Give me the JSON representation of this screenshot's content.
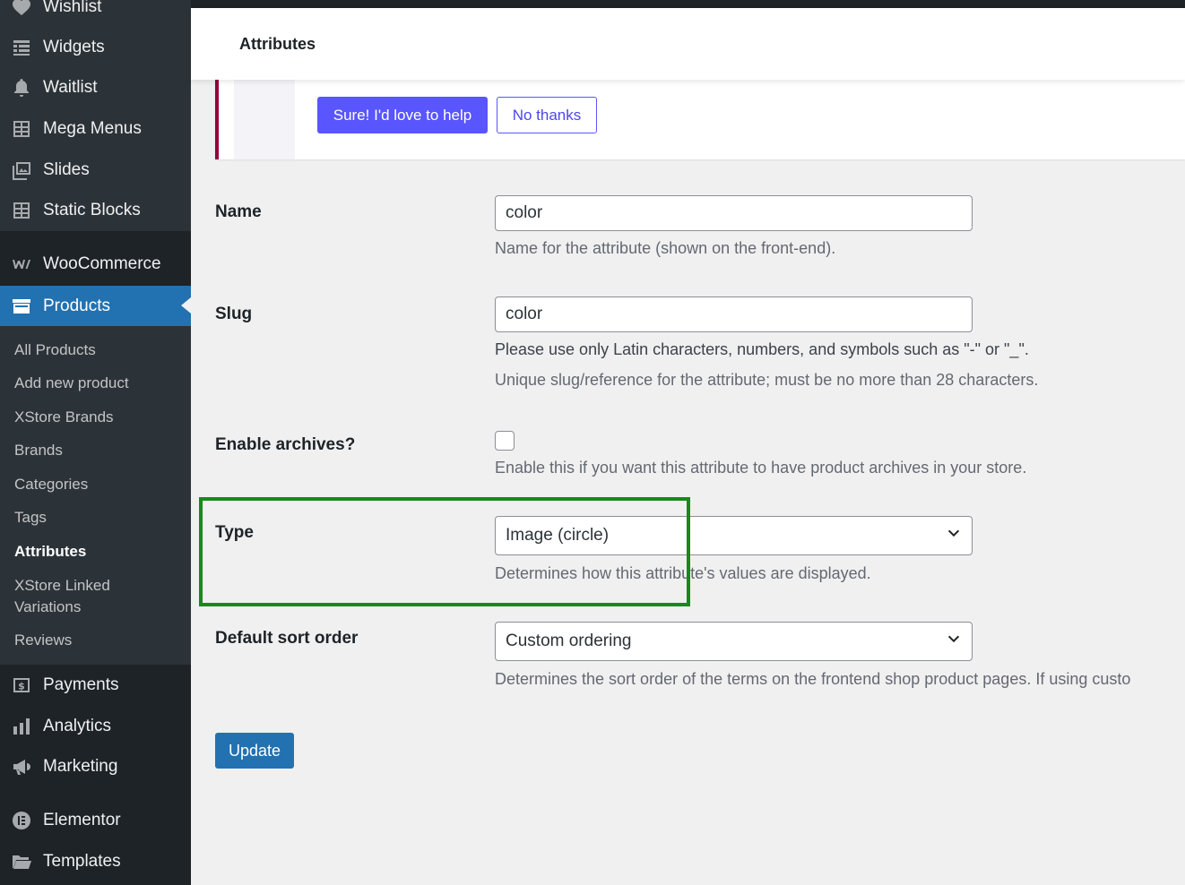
{
  "sidebar": {
    "top_items": [
      {
        "label": "Wishlist",
        "icon": "heart-icon"
      },
      {
        "label": "Widgets",
        "icon": "widgets-icon"
      },
      {
        "label": "Waitlist",
        "icon": "bell-icon"
      },
      {
        "label": "Mega Menus",
        "icon": "grid-icon"
      },
      {
        "label": "Slides",
        "icon": "slides-icon"
      },
      {
        "label": "Static Blocks",
        "icon": "grid-icon"
      }
    ],
    "woocommerce": "WooCommerce",
    "products": "Products",
    "submenu": [
      "All Products",
      "Add new product",
      "XStore Brands",
      "Brands",
      "Categories",
      "Tags",
      "Attributes",
      "XStore Linked\nVariations",
      "Reviews"
    ],
    "active_sub": "Attributes",
    "bottom_items": [
      {
        "label": "Payments",
        "icon": "dollar-icon"
      },
      {
        "label": "Analytics",
        "icon": "bar-chart-icon"
      },
      {
        "label": "Marketing",
        "icon": "megaphone-icon"
      },
      {
        "label": "Elementor",
        "icon": "elementor-icon"
      },
      {
        "label": "Templates",
        "icon": "folder-icon"
      }
    ]
  },
  "header": {
    "title": "Attributes"
  },
  "notice": {
    "primary_label": "Sure! I'd love to help",
    "secondary_label": "No thanks"
  },
  "form": {
    "name": {
      "label": "Name",
      "value": "color",
      "desc": "Name for the attribute (shown on the front-end)."
    },
    "slug": {
      "label": "Slug",
      "value": "color",
      "desc1": "Please use only Latin characters, numbers, and symbols such as \"-\" or \"_\".",
      "desc2": "Unique slug/reference for the attribute; must be no more than 28 characters."
    },
    "archives": {
      "label": "Enable archives?",
      "desc": "Enable this if you want this attribute to have product archives in your store."
    },
    "type": {
      "label": "Type",
      "value": "Image (circle)",
      "desc": "Determines how this attribute's values are displayed."
    },
    "sort": {
      "label": "Default sort order",
      "value": "Custom ordering",
      "desc": "Determines the sort order of the terms on the frontend shop product pages. If using custo"
    },
    "update_label": "Update"
  },
  "colors": {
    "accent": "#2271b1",
    "notice_button": "#5955ff",
    "highlight": "#178a17",
    "notice_border": "#93003c"
  }
}
